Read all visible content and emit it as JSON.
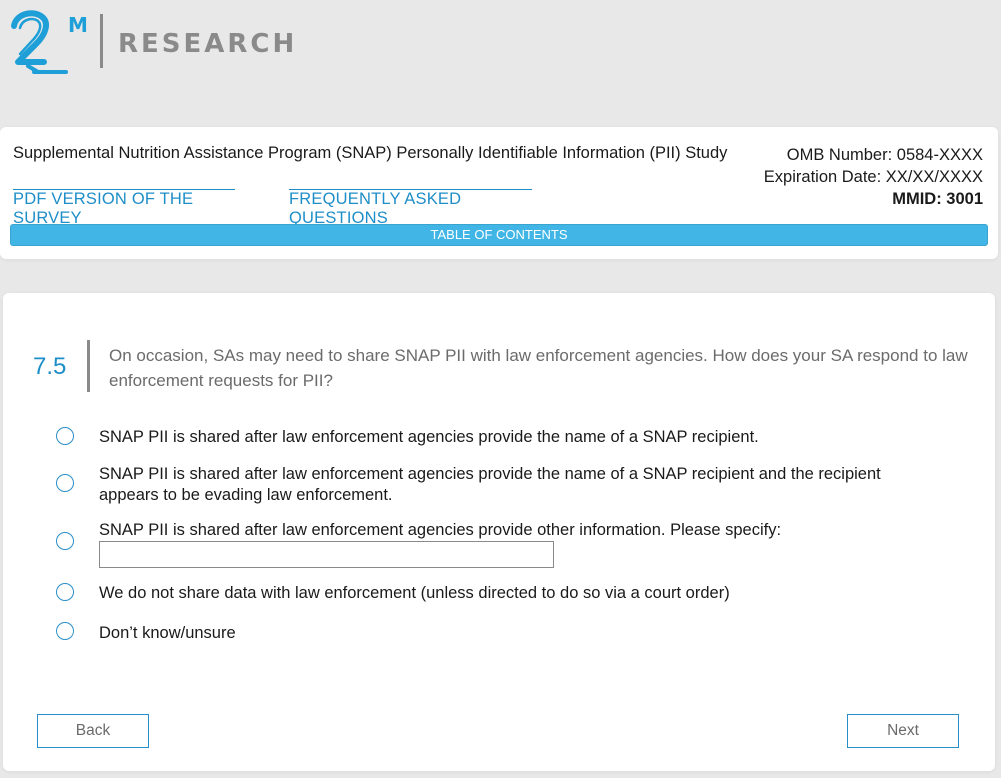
{
  "brand": {
    "mark_text": "2M",
    "wordmark": "RESEARCH",
    "accent": "#1e8ec8",
    "grey": "#8a8a8a"
  },
  "header": {
    "study_title": "Supplemental Nutrition Assistance Program (SNAP) Personally Identifiable Information (PII) Study",
    "omb_number": "OMB Number: 0584-XXXX",
    "expiration": "Expiration Date: XX/XX/XXXX",
    "mmid": "MMID: 3001",
    "pdf_link": "PDF VERSION OF THE SURVEY",
    "faq_link": "FREQUENTLY ASKED QUESTIONS",
    "toc_label": "TABLE OF CONTENTS",
    "toc_color": "#41b6e6"
  },
  "question": {
    "number": "7.5",
    "text": "On occasion, SAs may need to share SNAP PII with law enforcement agencies. How does your SA respond to law enforcement requests for PII?",
    "options": [
      {
        "label": "SNAP PII is shared after law enforcement agencies provide the name of a SNAP recipient."
      },
      {
        "label": "SNAP PII is shared after law enforcement agencies provide the name of a SNAP recipient and the recipient appears to be evading law enforcement."
      },
      {
        "label": "SNAP PII is shared after law enforcement agencies provide other information. Please specify:",
        "specify_value": ""
      },
      {
        "label": "We do not share data with law enforcement (unless directed to do so via a court order)"
      },
      {
        "label": "Don’t know/unsure"
      }
    ]
  },
  "navigation": {
    "back_label": "Back",
    "next_label": "Next"
  }
}
